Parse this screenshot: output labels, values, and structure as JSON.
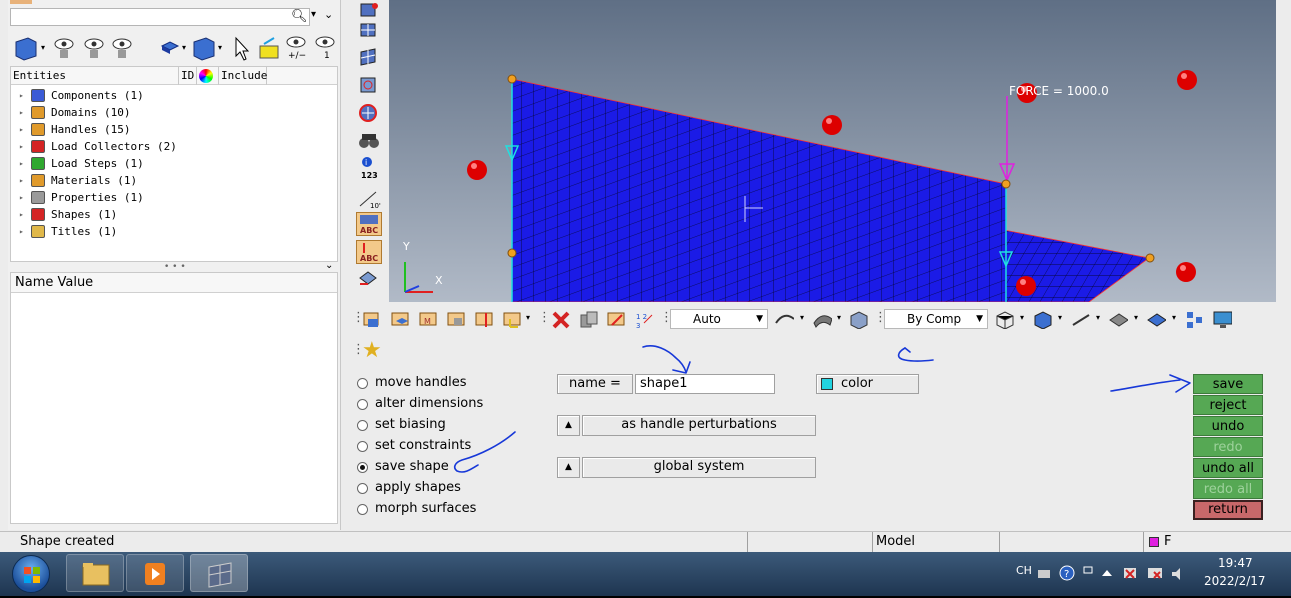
{
  "left_panel": {
    "tree_headers": {
      "entities": "Entities",
      "id": "ID",
      "include": "Include"
    },
    "tree_items": [
      {
        "label": "Components (1)",
        "icon": "component-icon",
        "color": "#3b5bd6"
      },
      {
        "label": "Domains (10)",
        "icon": "domain-icon",
        "color": "#e09a2b"
      },
      {
        "label": "Handles (15)",
        "icon": "handle-icon",
        "color": "#e09a2b"
      },
      {
        "label": "Load Collectors (2)",
        "icon": "load-collector-icon",
        "color": "#d42424"
      },
      {
        "label": "Load Steps (1)",
        "icon": "load-step-icon",
        "color": "#2fa82f"
      },
      {
        "label": "Materials (1)",
        "icon": "material-icon",
        "color": "#e09a2b"
      },
      {
        "label": "Properties (1)",
        "icon": "property-icon",
        "color": "#9a9a9a"
      },
      {
        "label": "Shapes (1)",
        "icon": "shape-icon",
        "color": "#d42424"
      },
      {
        "label": "Titles (1)",
        "icon": "title-icon",
        "color": "#e0b84a"
      }
    ],
    "name_value_header": "Name Value"
  },
  "viewport": {
    "force_label": "FORCE = 1000.0",
    "axis_y": "Y",
    "axis_x": "X",
    "counter_label": "123"
  },
  "toolbar": {
    "auto_dropdown": "Auto",
    "bycomp_dropdown": "By Comp"
  },
  "panel": {
    "radios": [
      {
        "label": "move handles",
        "selected": false
      },
      {
        "label": "alter dimensions",
        "selected": false
      },
      {
        "label": "set biasing",
        "selected": false
      },
      {
        "label": "set constraints",
        "selected": false
      },
      {
        "label": "save shape",
        "selected": true
      },
      {
        "label": "apply shapes",
        "selected": false
      },
      {
        "label": "morph surfaces",
        "selected": false
      }
    ],
    "name_button": "name =",
    "name_value": "shape1",
    "color_button": "color",
    "color_swatch": "#22d3e0",
    "perturb_button": "as handle perturbations",
    "system_button": "global system",
    "actions": [
      {
        "label": "save",
        "enabled": true
      },
      {
        "label": "reject",
        "enabled": true
      },
      {
        "label": "undo",
        "enabled": true
      },
      {
        "label": "redo",
        "enabled": false
      },
      {
        "label": "undo all",
        "enabled": true
      },
      {
        "label": "redo all",
        "enabled": false
      }
    ],
    "return_button": "return"
  },
  "status_bar": {
    "message": "Shape created",
    "model": "Model",
    "component_indicator": "F"
  },
  "taskbar": {
    "lang": "CH",
    "time": "19:47",
    "date": "2022/2/17"
  },
  "colors": {
    "mesh_blue": "#1b1be6",
    "action_green": "#56a854",
    "return_red": "#c8686a",
    "force_magenta": "#e020e0",
    "handle_red": "#dd0000"
  }
}
